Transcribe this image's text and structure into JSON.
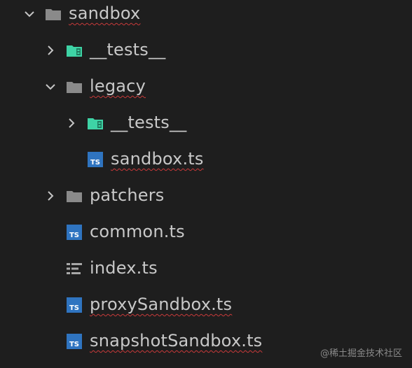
{
  "tree": {
    "items": [
      {
        "label": "sandbox"
      },
      {
        "label": "__tests__"
      },
      {
        "label": "legacy"
      },
      {
        "label": "__tests__"
      },
      {
        "label": "sandbox.ts"
      },
      {
        "label": "patchers"
      },
      {
        "label": "common.ts"
      },
      {
        "label": "index.ts"
      },
      {
        "label": "proxySandbox.ts"
      },
      {
        "label": "snapshotSandbox.ts"
      }
    ]
  },
  "icons": {
    "folder": "folder-icon",
    "test_folder": "test-folder-icon",
    "typescript": "typescript-file-icon",
    "index": "index-file-icon",
    "chevron_down": "chevron-down-icon",
    "chevron_right": "chevron-right-icon"
  },
  "colors": {
    "background": "#1e1e1e",
    "text": "#c8c8c8",
    "folder": "#8a8a8a",
    "test_folder": "#3ed3a5",
    "typescript": "#2f74c0",
    "error_underline": "#c83a3a"
  },
  "watermark": {
    "text": "@稀土掘金技术社区"
  }
}
